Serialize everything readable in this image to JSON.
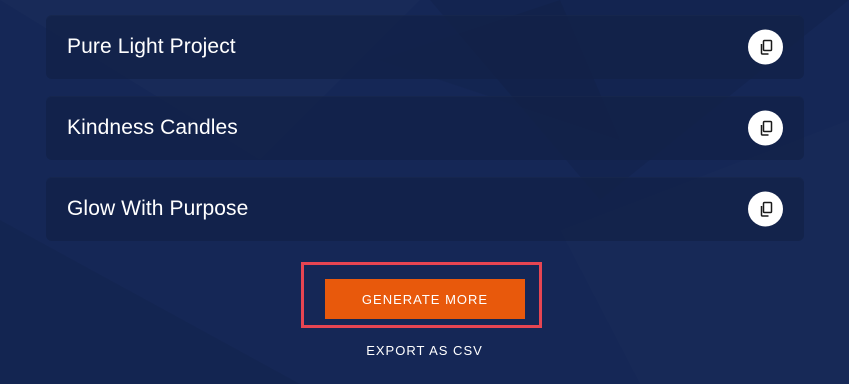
{
  "items": [
    {
      "name": "Pure Light Project",
      "action_icon": "copy-icon"
    },
    {
      "name": "Kindness Candles",
      "action_icon": "copy-icon"
    },
    {
      "name": "Glow With Purpose",
      "action_icon": "copy-icon"
    }
  ],
  "actions": {
    "generate_label": "GENERATE MORE",
    "export_label": "EXPORT AS CSV"
  },
  "colors": {
    "background": "#152756",
    "card": "#122148",
    "accent": "#e8590c",
    "highlight": "#e64552"
  }
}
